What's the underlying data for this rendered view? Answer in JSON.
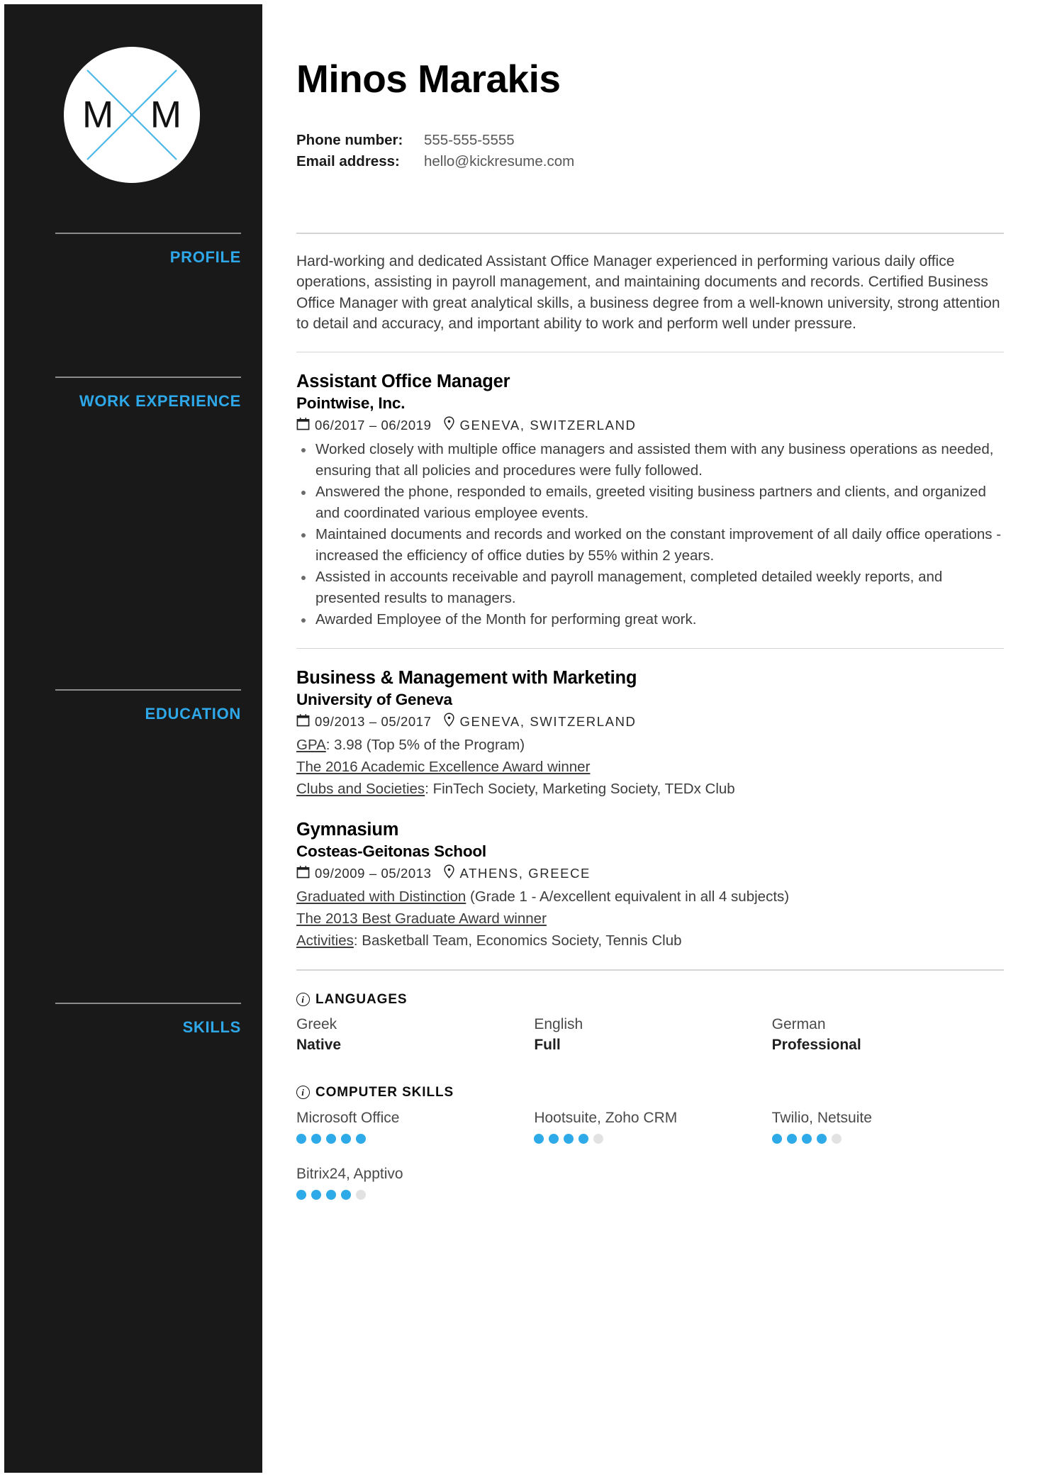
{
  "header": {
    "name": "Minos Marakis",
    "logo": {
      "left_letter": "M",
      "right_letter": "M"
    },
    "contacts": [
      {
        "label": "Phone number:",
        "value": "555-555-5555"
      },
      {
        "label": "Email address:",
        "value": "hello@kickresume.com"
      }
    ]
  },
  "sidebar": {
    "sections": [
      {
        "label": "PROFILE"
      },
      {
        "label": "WORK EXPERIENCE"
      },
      {
        "label": "EDUCATION"
      },
      {
        "label": "SKILLS"
      }
    ],
    "accent_color": "#2ea8e8",
    "background_color": "#191919"
  },
  "profile": {
    "text": "Hard-working and dedicated Assistant Office Manager experienced in performing various daily office operations, assisting in payroll management, and maintaining documents and records. Certified Business Office Manager with great analytical skills, a business degree from a well-known university, strong attention to detail and accuracy, and important ability to work and perform well under pressure."
  },
  "work_experience": [
    {
      "title": "Assistant Office Manager",
      "company": "Pointwise, Inc.",
      "dates": "06/2017 – 06/2019",
      "location": "GENEVA, SWITZERLAND",
      "bullets": [
        "Worked closely with multiple office managers and assisted them with any business operations as needed, ensuring that all policies and procedures were fully followed.",
        "Answered the phone, responded to emails, greeted visiting business partners and clients, and organized and coordinated various employee events.",
        "Maintained documents and records and worked on the constant improvement of all daily office operations - increased the efficiency of office duties by 55% within 2 years.",
        "Assisted in accounts receivable and payroll management, completed detailed weekly reports, and presented results to managers.",
        "Awarded Employee of the Month for performing great work."
      ]
    }
  ],
  "education": [
    {
      "title": "Business & Management with Marketing",
      "school": "University of Geneva",
      "dates": "09/2013 – 05/2017",
      "location": "GENEVA, SWITZERLAND",
      "lines": [
        {
          "label": "GPA",
          "rest": ": 3.98 (Top 5% of the Program)"
        },
        {
          "label": "The 2016 Academic Excellence Award winner",
          "rest": ""
        },
        {
          "label": "Clubs and Societies",
          "rest": ": FinTech Society, Marketing Society, TEDx Club"
        }
      ]
    },
    {
      "title": "Gymnasium",
      "school": "Costeas-Geitonas School",
      "dates": "09/2009 – 05/2013",
      "location": "ATHENS, GREECE",
      "lines": [
        {
          "label": "Graduated with Distinction",
          "rest": " (Grade 1 - A/excellent equivalent in all 4 subjects)"
        },
        {
          "label": "The 2013 Best Graduate Award winner",
          "rest": ""
        },
        {
          "label": "Activities",
          "rest": ": Basketball Team, Economics Society, Tennis Club"
        }
      ]
    }
  ],
  "skills": {
    "languages": {
      "heading": "LANGUAGES",
      "items": [
        {
          "name": "Greek",
          "level": "Native"
        },
        {
          "name": "English",
          "level": "Full"
        },
        {
          "name": "German",
          "level": "Professional"
        }
      ]
    },
    "computer_skills": {
      "heading": "COMPUTER SKILLS",
      "max_rating": 5,
      "items": [
        {
          "name": "Microsoft Office",
          "rating": 5
        },
        {
          "name": "Hootsuite, Zoho CRM",
          "rating": 4
        },
        {
          "name": "Twilio, Netsuite",
          "rating": 4
        },
        {
          "name": "Bitrix24, Apptivo",
          "rating": 4
        }
      ]
    }
  }
}
